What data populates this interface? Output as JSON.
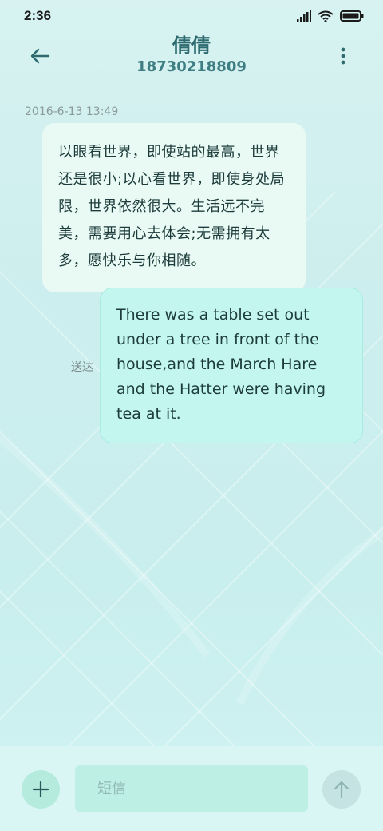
{
  "status_bar": {
    "time": "2:36",
    "icons": [
      "signal-icon",
      "wifi-icon",
      "battery-icon"
    ]
  },
  "header": {
    "back_icon": "arrow-left-icon",
    "contact_name": "倩倩",
    "contact_number": "18730218809",
    "more_icon": "more-vertical-icon"
  },
  "conversation": {
    "timestamp": "2016-6-13 13:49",
    "messages": [
      {
        "direction": "incoming",
        "text": "以眼看世界，即使站的最高，世界还是很小;以心看世界，即使身处局限，世界依然很大。生活远不完美，需要用心去体会;无需拥有太多，愿快乐与你相随。"
      },
      {
        "direction": "outgoing",
        "text": "There was a table set out under a tree in front of the house,and the March Hare and the Hatter were having tea at it.",
        "status": "送达"
      }
    ]
  },
  "composer": {
    "add_icon": "plus-icon",
    "placeholder": "短信",
    "value": "",
    "send_icon": "arrow-up-icon"
  },
  "colors": {
    "accent": "#2d6b70",
    "incoming_bubble": "#e9faf4",
    "outgoing_bubble": "#c3f6ee",
    "input_background": "#bdefe5",
    "add_button": "#b4ebdd",
    "send_button_disabled": "#c5e3e3"
  }
}
